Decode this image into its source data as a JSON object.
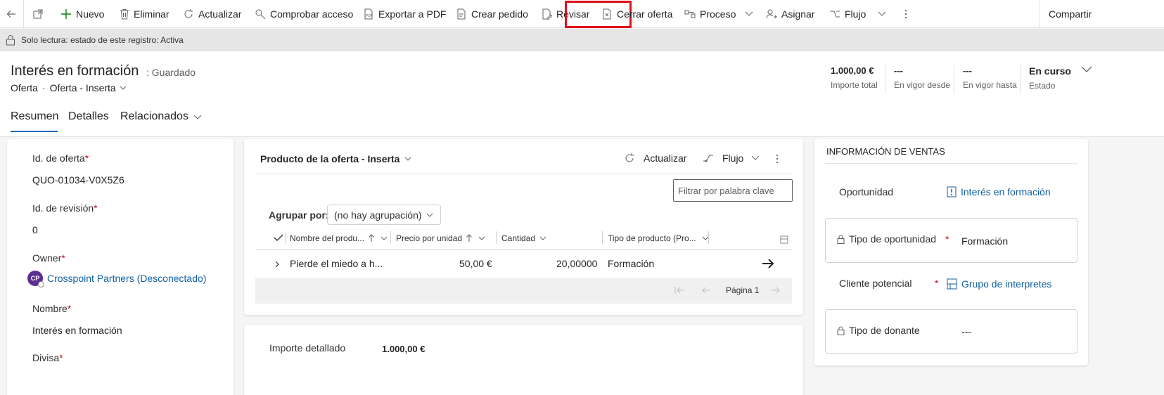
{
  "commandbar": {
    "new": "Nuevo",
    "delete": "Eliminar",
    "refresh": "Actualizar",
    "check_access": "Comprobar acceso",
    "export_pdf": "Exportar a PDF",
    "create_order": "Crear pedido",
    "revise": "Revisar",
    "close_quote": "Cerrar oferta",
    "process": "Proceso",
    "assign": "Asignar",
    "flow": "Flujo",
    "share": "Compartir"
  },
  "readonly_bar": {
    "text": "Solo lectura: estado de este registro: Activa"
  },
  "header": {
    "title": "Interés en formación",
    "saved_status": ": Guardado",
    "entity": "Oferta",
    "form": "Oferta - Inserta",
    "fields": [
      {
        "value": "1.000,00 €",
        "label": "Importe total"
      },
      {
        "value": "---",
        "label": "En vigor desde"
      },
      {
        "value": "---",
        "label": "En vigor hasta"
      },
      {
        "value": "En curso",
        "label": "Estado"
      }
    ]
  },
  "tabs": [
    "Resumen",
    "Detalles",
    "Relacionados"
  ],
  "left_card": {
    "quote_id_label": "Id. de oferta",
    "quote_id_value": "QUO-01034-V0X5Z6",
    "revision_label": "Id. de revisión",
    "revision_value": "0",
    "owner_label": "Owner",
    "owner_initials": "CP",
    "owner_value": "Crosspoint Partners (Desconectado)",
    "name_label": "Nombre",
    "name_value": "Interés en formación",
    "currency_label": "Divisa"
  },
  "products": {
    "title": "Producto de la oferta - Inserta",
    "refresh": "Actualizar",
    "flow": "Flujo",
    "filter_placeholder": "Filtrar por palabra clave",
    "group_by_label": "Agrupar por:",
    "group_by_value": "(no hay agrupación)",
    "columns": [
      "Nombre del produ...",
      "Precio por unidad",
      "Cantidad",
      "Tipo de producto (Pro..."
    ],
    "rows": [
      {
        "name": "Pierde el miedo a h...",
        "price": "50,00 €",
        "quantity": "20,00000",
        "type": "Formación"
      }
    ],
    "page_label": "Página 1"
  },
  "detail_amount": {
    "label": "Importe detallado",
    "value": "1.000,00 €"
  },
  "sales_info": {
    "title": "INFORMACIÓN DE VENTAS",
    "opportunity_label": "Oportunidad",
    "opportunity_value": "Interés en formación",
    "opp_type_label": "Tipo de oportunidad",
    "opp_type_value": "Formación",
    "prospect_label": "Cliente potencial",
    "prospect_value": "Grupo de interpretes",
    "donor_type_label": "Tipo de donante",
    "donor_type_value": "---"
  },
  "colors": {
    "accent": "#0f6cbd",
    "highlight": "#e0101b",
    "link": "#115ea3",
    "required": "#c50f1f"
  }
}
